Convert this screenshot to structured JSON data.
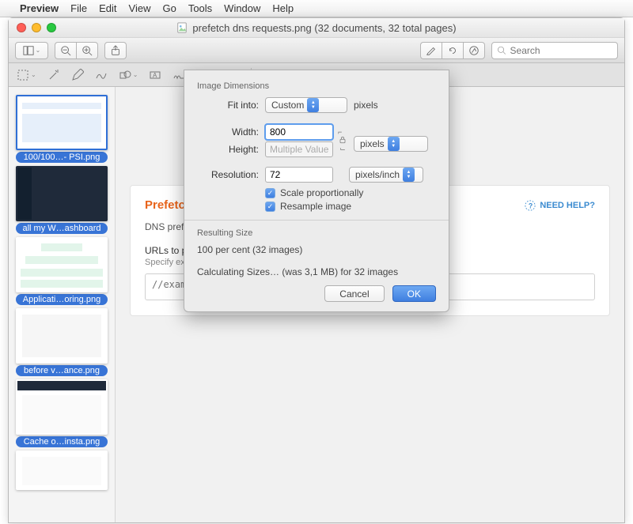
{
  "menubar": {
    "app": "Preview",
    "items": [
      "File",
      "Edit",
      "View",
      "Go",
      "Tools",
      "Window",
      "Help"
    ]
  },
  "window": {
    "title": "prefetch dns requests.png (32 documents, 32 total pages)"
  },
  "search": {
    "placeholder": "Search"
  },
  "sidebar": {
    "items": [
      {
        "label": "100/100…- PSI.png"
      },
      {
        "label": "all my W…ashboard"
      },
      {
        "label": "Applicati…oring.png"
      },
      {
        "label": "before v…ance.png"
      },
      {
        "label": "Cache o…insta.png"
      },
      {
        "label": ""
      }
    ]
  },
  "doc": {
    "heading": "Prefetch DNS Re",
    "help": "NEED HELP?",
    "desc": "DNS prefetching ca",
    "fieldLabel": "URLs to prefetc",
    "fieldHint": "Specify external h",
    "placeholder": "//example.com"
  },
  "dialog": {
    "section1": "Image Dimensions",
    "fitLabel": "Fit into:",
    "fitValue": "Custom",
    "fitSuffix": "pixels",
    "widthLabel": "Width:",
    "widthValue": "800",
    "heightLabel": "Height:",
    "heightValue": "Multiple Values",
    "unitValue": "pixels",
    "resLabel": "Resolution:",
    "resValue": "72",
    "resUnit": "pixels/inch",
    "scale": "Scale proportionally",
    "resample": "Resample image",
    "section2": "Resulting Size",
    "result1": "100 per cent (32 images)",
    "result2": "Calculating Sizes… (was 3,1 MB) for 32 images",
    "cancel": "Cancel",
    "ok": "OK"
  }
}
